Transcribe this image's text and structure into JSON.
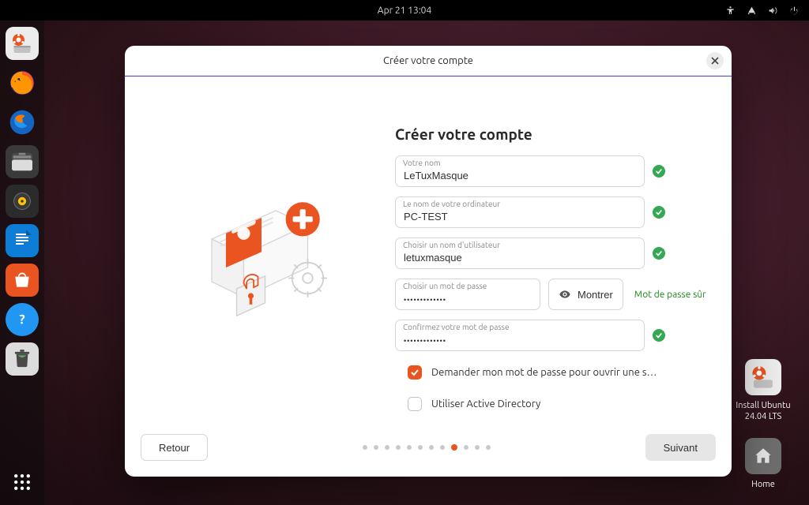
{
  "topbar": {
    "datetime": "Apr 21  13:04"
  },
  "desktop": {
    "install_label_1": "Install Ubuntu",
    "install_label_2": "24.04 LTS",
    "home_label": "Home"
  },
  "installer": {
    "window_title": "Créer votre compte",
    "heading": "Créer votre compte",
    "fields": {
      "name_label": "Votre nom",
      "name_value": "LeTuxMasque",
      "pcname_label": "Le nom de votre ordinateur",
      "pcname_value": "PC-TEST",
      "username_label": "Choisir un nom d'utilisateur",
      "username_value": "letuxmasque",
      "password_label": "Choisir un mot de passe",
      "password_value": "•••••••••••••",
      "confirm_label": "Confirmez votre mot de passe",
      "confirm_value": "•••••••••••••"
    },
    "show_password_btn": "Montrer",
    "password_strength": "Mot de passe sûr",
    "checkbox1_label": "Demander mon mot de passe pour ouvrir une s…",
    "checkbox2_label": "Utiliser Active Directory",
    "back_btn": "Retour",
    "next_btn": "Suivant",
    "steps_total": 12,
    "step_active": 9
  }
}
